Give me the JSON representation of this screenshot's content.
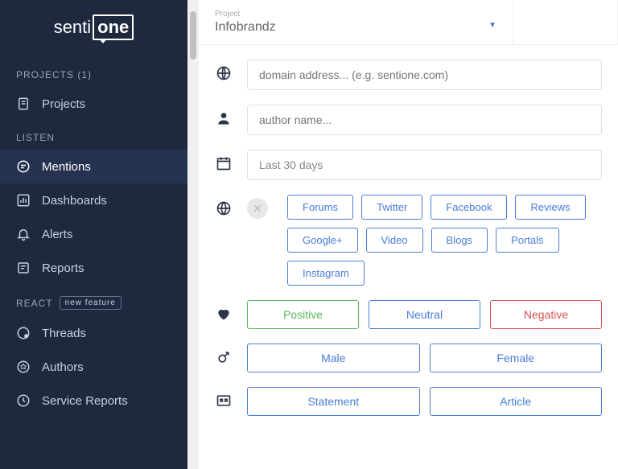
{
  "sidebar": {
    "sections": {
      "projects": {
        "label": "PROJECTS (1)",
        "items": [
          {
            "label": "Projects"
          }
        ]
      },
      "listen": {
        "label": "LISTEN",
        "items": [
          {
            "label": "Mentions"
          },
          {
            "label": "Dashboards"
          },
          {
            "label": "Alerts"
          },
          {
            "label": "Reports"
          }
        ]
      },
      "react": {
        "label": "REACT",
        "badge": "new feature",
        "items": [
          {
            "label": "Threads"
          },
          {
            "label": "Authors"
          },
          {
            "label": "Service Reports"
          }
        ]
      }
    }
  },
  "project": {
    "label": "Project",
    "value": "Infobrandz"
  },
  "filters": {
    "domain_placeholder": "domain address... (e.g. sentione.com)",
    "author_placeholder": "author name...",
    "date_value": "Last 30 days",
    "sources": [
      "Forums",
      "Twitter",
      "Facebook",
      "Reviews",
      "Google+",
      "Video",
      "Blogs",
      "Portals",
      "Instagram"
    ],
    "sentiments": {
      "positive": "Positive",
      "neutral": "Neutral",
      "negative": "Negative"
    },
    "gender": [
      "Male",
      "Female"
    ],
    "content_type": [
      "Statement",
      "Article"
    ]
  }
}
